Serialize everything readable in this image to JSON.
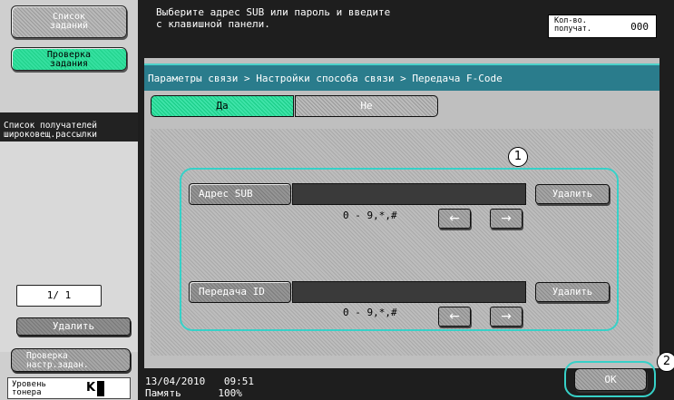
{
  "sidebar": {
    "job_list_label": [
      "Список",
      "заданий"
    ],
    "job_check_label": [
      "Проверка",
      "задания"
    ],
    "broadcast_header": [
      "Список получателей",
      "широковещ.рассылки"
    ],
    "page_counter": "1/ 1",
    "delete_label": "Удалить",
    "check_settings_label": [
      "Проверка",
      "настр.задан."
    ],
    "toner": {
      "label": [
        "Уровень",
        "тонера"
      ],
      "color": "K"
    }
  },
  "header": {
    "message": [
      "Выберите адрес SUB или пароль и введите",
      "с клавишной панели."
    ],
    "recipient_label": [
      "Кол-во.",
      "получат."
    ],
    "recipient_count": "000"
  },
  "breadcrumb": "Параметры связи > Настройки способа связи > Передача F-Code",
  "toggle": {
    "yes": "Да",
    "no": "Не"
  },
  "fields": [
    {
      "label": "Адрес SUB",
      "value": "",
      "hint": "0 - 9,*,#",
      "delete_label": "Удалить"
    },
    {
      "label": "Передача ID",
      "value": "",
      "hint": "0 - 9,*,#",
      "delete_label": "Удалить"
    }
  ],
  "arrows": {
    "left": "←",
    "right": "→"
  },
  "callouts": [
    "1",
    "2"
  ],
  "status": {
    "date": "13/04/2010",
    "time": "09:51",
    "memory_label": "Память",
    "memory_value": "100%"
  },
  "ok_label": "OK",
  "colors": {
    "accent_green": "#2fd99a",
    "breadcrumb_bg": "#2a7c8c",
    "callout_border": "#37d1c8",
    "dark_bg": "#1e1e1e"
  }
}
